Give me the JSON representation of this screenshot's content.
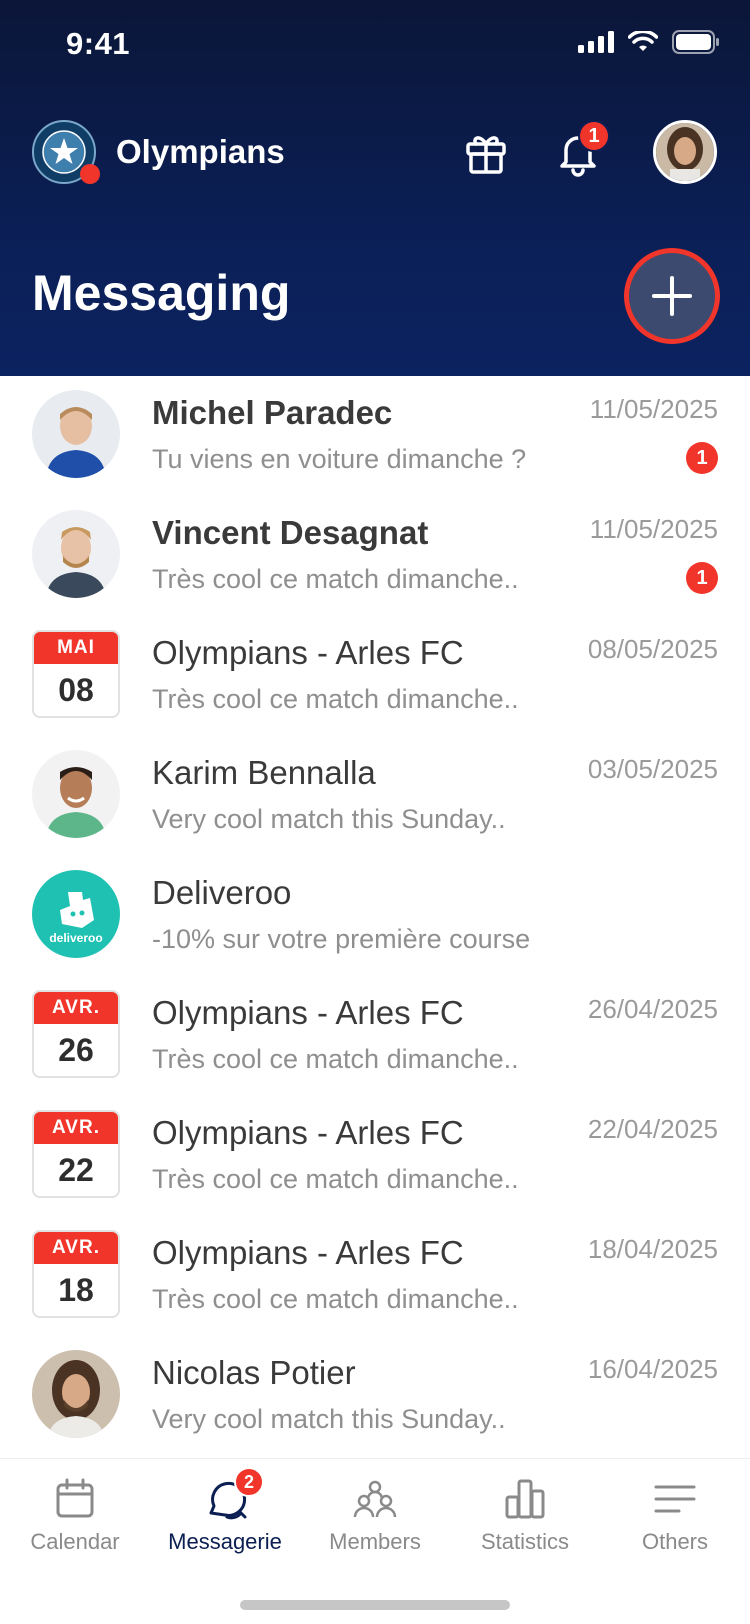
{
  "status_bar": {
    "time": "9:41"
  },
  "header": {
    "club_name": "Olympians",
    "notification_count": "1",
    "page_title": "Messaging"
  },
  "messages": [
    {
      "kind": "avatar",
      "title": "Michel Paradec",
      "preview": "Tu viens en voiture dimanche ?",
      "date": "11/05/2025",
      "unread": "1",
      "bold": true
    },
    {
      "kind": "avatar",
      "title": "Vincent Desagnat",
      "preview": "Très cool ce match dimanche..",
      "date": "11/05/2025",
      "unread": "1",
      "bold": true
    },
    {
      "kind": "calendar",
      "month": "MAI",
      "day": "08",
      "title": "Olympians - Arles FC",
      "preview": "Très cool ce match dimanche..",
      "date": "08/05/2025"
    },
    {
      "kind": "avatar",
      "title": "Karim Bennalla",
      "preview": "Very cool match this Sunday..",
      "date": "03/05/2025"
    },
    {
      "kind": "brand",
      "brand_label": "deliveroo",
      "title": "Deliveroo",
      "preview": "-10% sur votre première course",
      "date": ""
    },
    {
      "kind": "calendar",
      "month": "AVR.",
      "day": "26",
      "title": "Olympians - Arles FC",
      "preview": "Très cool ce match dimanche..",
      "date": "26/04/2025"
    },
    {
      "kind": "calendar",
      "month": "AVR.",
      "day": "22",
      "title": "Olympians - Arles FC",
      "preview": "Très cool ce match dimanche..",
      "date": "22/04/2025"
    },
    {
      "kind": "calendar",
      "month": "AVR.",
      "day": "18",
      "title": "Olympians - Arles FC",
      "preview": "Très cool ce match dimanche..",
      "date": "18/04/2025"
    },
    {
      "kind": "avatar",
      "title": "Nicolas Potier",
      "preview": "Very cool match this Sunday..",
      "date": "16/04/2025"
    }
  ],
  "tabbar": {
    "tabs": [
      {
        "label": "Calendar",
        "icon": "calendar-icon"
      },
      {
        "label": "Messagerie",
        "icon": "chat-icon",
        "badge": "2",
        "active": true
      },
      {
        "label": "Members",
        "icon": "members-icon"
      },
      {
        "label": "Statistics",
        "icon": "statistics-icon"
      },
      {
        "label": "Others",
        "icon": "menu-icon"
      }
    ]
  },
  "colors": {
    "header_top": "#0b1638",
    "header_bottom": "#0c2361",
    "accent_red": "#f2352b",
    "deliveroo": "#1fc2b2",
    "active_tab": "#0c1f52"
  }
}
